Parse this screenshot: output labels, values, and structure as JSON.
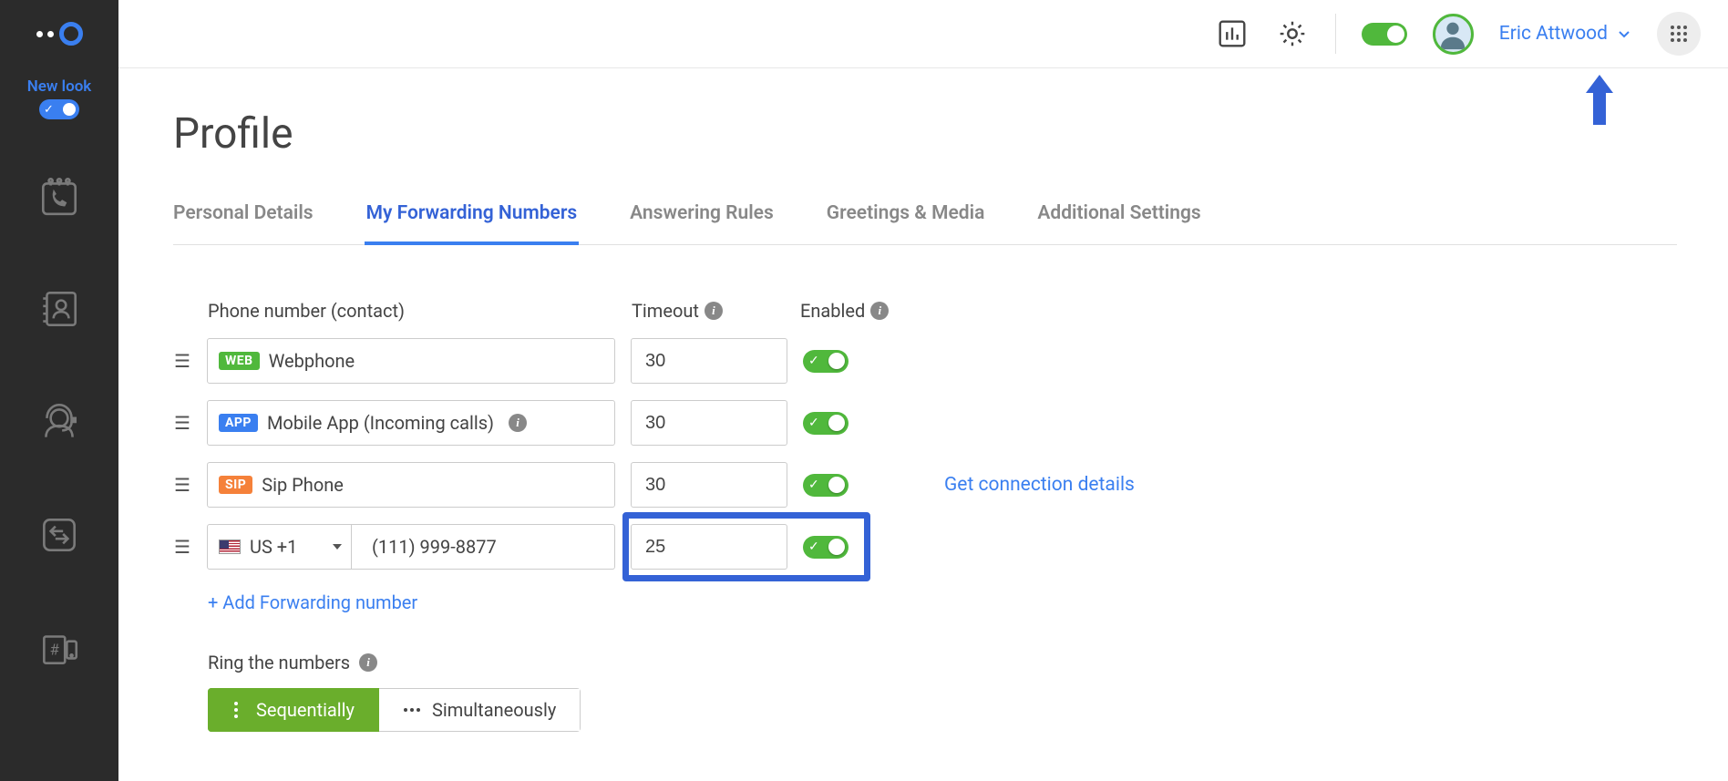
{
  "user": {
    "name": "Eric Attwood"
  },
  "sidebar": {
    "new_look_label": "New look"
  },
  "page": {
    "title": "Profile"
  },
  "tabs": [
    {
      "label": "Personal Details",
      "active": false
    },
    {
      "label": "My Forwarding Numbers",
      "active": true
    },
    {
      "label": "Answering Rules",
      "active": false
    },
    {
      "label": "Greetings & Media",
      "active": false
    },
    {
      "label": "Additional Settings",
      "active": false
    }
  ],
  "columns": {
    "phone": "Phone number (contact)",
    "timeout": "Timeout",
    "enabled": "Enabled"
  },
  "rows": [
    {
      "badge": "WEB",
      "badge_class": "web",
      "label": "Webphone",
      "timeout": "30",
      "enabled": true,
      "has_info": false
    },
    {
      "badge": "APP",
      "badge_class": "app",
      "label": "Mobile App (Incoming calls)",
      "timeout": "30",
      "enabled": true,
      "has_info": true
    },
    {
      "badge": "SIP",
      "badge_class": "sip",
      "label": "Sip Phone",
      "timeout": "30",
      "enabled": true,
      "link": "Get connection details"
    }
  ],
  "custom_row": {
    "country": "US +1",
    "number": "(111) 999-8877",
    "timeout": "25",
    "enabled": true
  },
  "add_label": "+ Add Forwarding number",
  "ring": {
    "label": "Ring the numbers",
    "seq": "Sequentially",
    "sim": "Simultaneously"
  },
  "conn_details": "Get connection details"
}
